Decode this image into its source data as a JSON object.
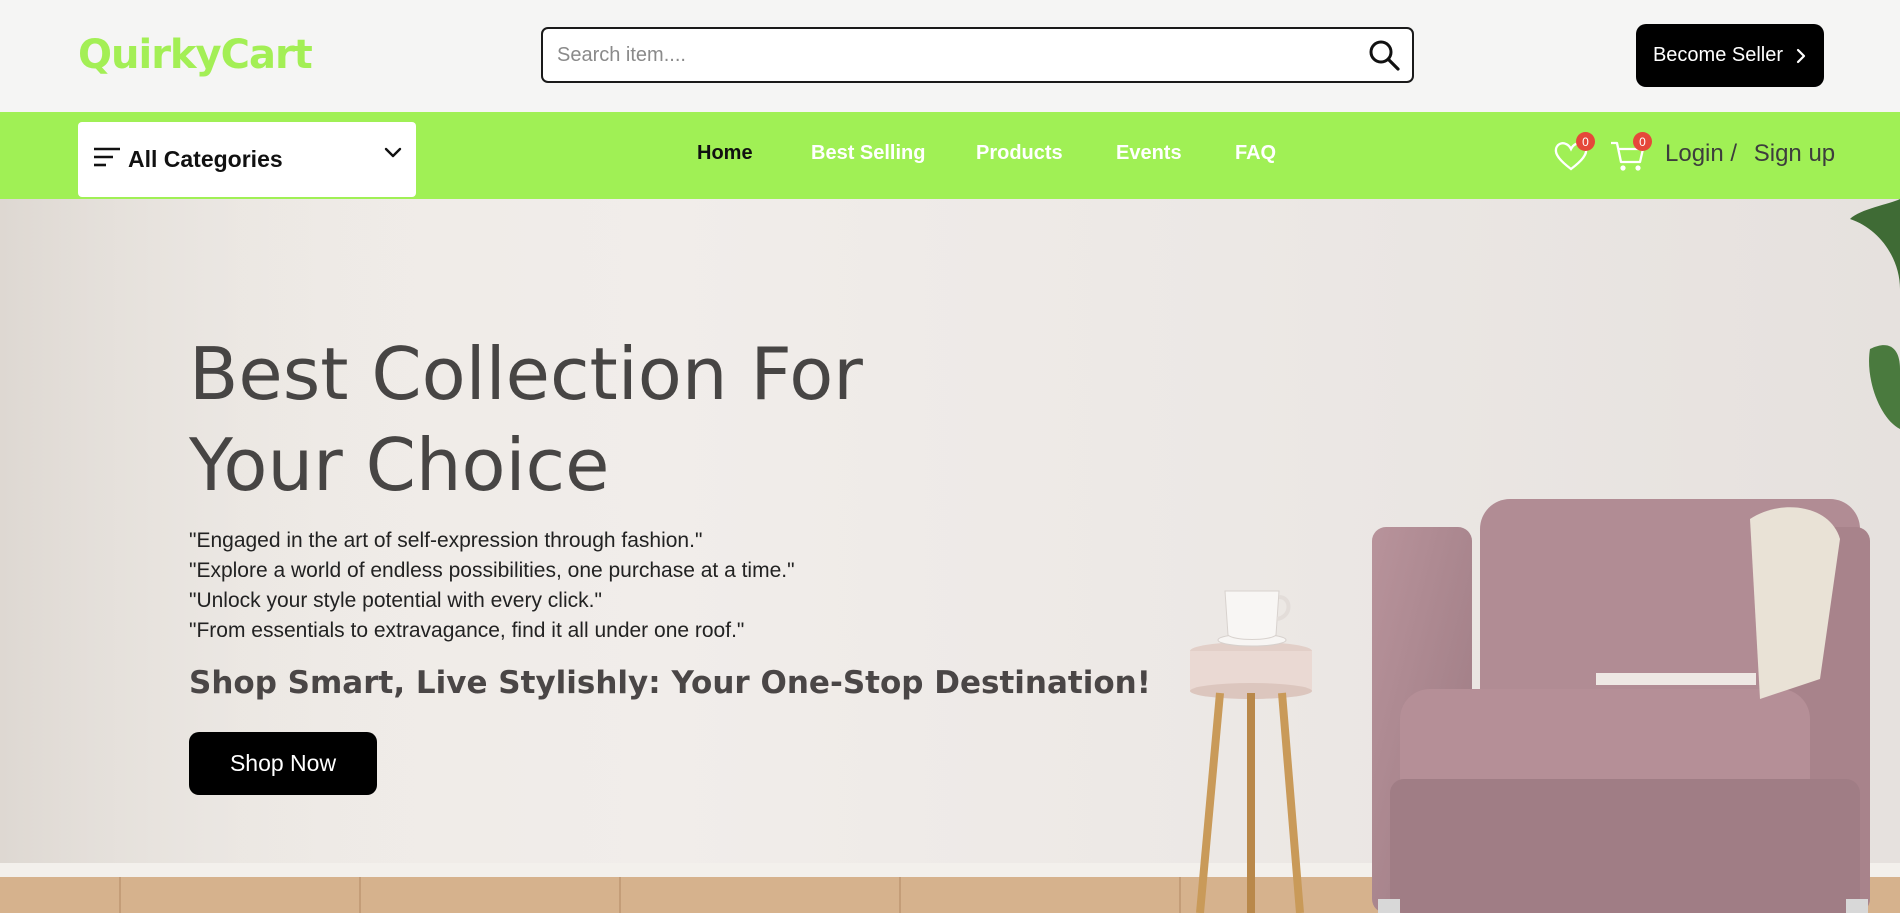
{
  "header": {
    "logo": "QuirkyCart",
    "search": {
      "placeholder": "Search item....",
      "value": ""
    },
    "become_seller": "Become Seller"
  },
  "nav": {
    "categories_label": "All Categories",
    "links": [
      {
        "label": "Home",
        "active": true
      },
      {
        "label": "Best Selling",
        "active": false
      },
      {
        "label": "Products",
        "active": false
      },
      {
        "label": "Events",
        "active": false
      },
      {
        "label": "FAQ",
        "active": false
      }
    ],
    "wishlist_count": "0",
    "cart_count": "0",
    "login": "Login /",
    "signup": "Sign up"
  },
  "hero": {
    "title_line1": "Best Collection For",
    "title_line2": "Your Choice",
    "taglines": [
      "\"Engaged in the art of self-expression through fashion.\"",
      "\"Explore a world of endless possibilities, one purchase at a time.\"",
      "\"Unlock your style potential with every click.\"",
      "\"From essentials to extravagance, find it all under one roof.\""
    ],
    "subhead": "Shop Smart, Live Stylishly: Your One-Stop Destination!",
    "cta": "Shop Now"
  },
  "colors": {
    "brand_green": "#a0f055",
    "logo_green": "#a3ef55",
    "button_black": "#000000",
    "badge_red": "#e5483a"
  },
  "icons": [
    "search-icon",
    "chevron-right-icon",
    "menu-icon",
    "chevron-down-icon",
    "heart-icon",
    "cart-icon"
  ]
}
